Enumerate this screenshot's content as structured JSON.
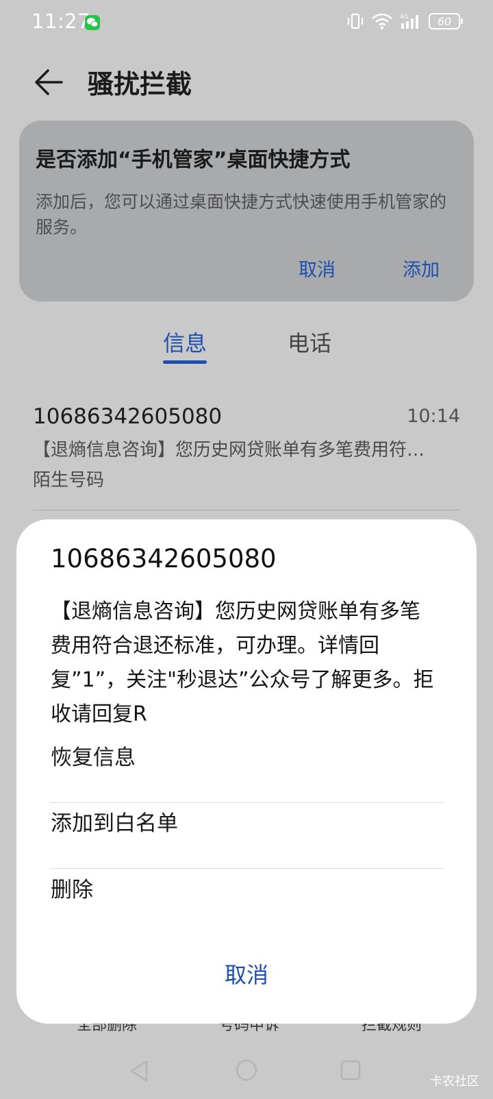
{
  "status_bar": {
    "time": "11:27",
    "battery": "60"
  },
  "header": {
    "title": "骚扰拦截"
  },
  "shortcut_card": {
    "title": "是否添加“手机管家”桌面快捷方式",
    "description": "添加后，您可以通过桌面快捷方式快速使用手机管家的服务。",
    "cancel_label": "取消",
    "add_label": "添加"
  },
  "tabs": [
    {
      "label": "信息",
      "selected": true
    },
    {
      "label": "电话",
      "selected": false
    }
  ],
  "message_item": {
    "number": "10686342605080",
    "time": "10:14",
    "preview": "【退熵信息咨询】您历史网贷账单有多笔费用符…",
    "tag": "陌生号码"
  },
  "bottom_toolbar": {
    "items": [
      "全部删除",
      "号码申诉",
      "拦截规则"
    ]
  },
  "sheet": {
    "title": "10686342605080",
    "body": "【退熵信息咨询】您历史网贷账单有多笔费用符合退还标准，可办理。详情回复”1”，关注\"秒退达”公众号了解更多。拒收请回复R",
    "options": [
      "恢复信息",
      "添加到白名单",
      "删除"
    ],
    "cancel_label": "取消"
  },
  "watermark": "卡农社区",
  "colors": {
    "accent": "#1d4fb0",
    "background": "#c9c9c9",
    "card": "#a9aaac",
    "wechat": "#2bc24a"
  }
}
